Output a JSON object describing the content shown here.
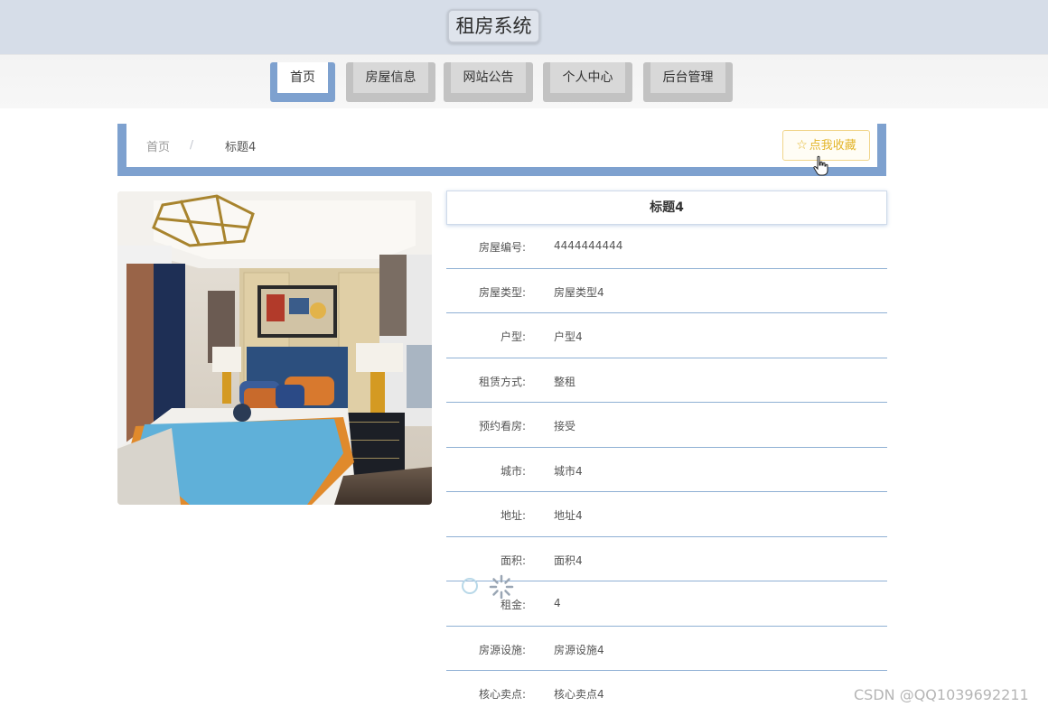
{
  "header": {
    "site_title": "租房系统"
  },
  "nav": {
    "items": [
      "首页",
      "房屋信息",
      "网站公告",
      "个人中心",
      "后台管理"
    ],
    "active": "首页"
  },
  "breadcrumb": {
    "home": "首页",
    "separator": "/",
    "current": "标题4"
  },
  "favorite_button": {
    "label": "点我收藏",
    "icon": "star-outline-icon"
  },
  "detail": {
    "title": "标题4",
    "fields": [
      {
        "label": "房屋编号:",
        "value": "4444444444"
      },
      {
        "label": "房屋类型:",
        "value": "房屋类型4"
      },
      {
        "label": "户型:",
        "value": "户型4"
      },
      {
        "label": "租赁方式:",
        "value": "整租"
      },
      {
        "label": "预约看房:",
        "value": "接受"
      },
      {
        "label": "城市:",
        "value": "城市4"
      },
      {
        "label": "地址:",
        "value": "地址4"
      },
      {
        "label": "面积:",
        "value": "面积4"
      },
      {
        "label": "租金:",
        "value": "4"
      },
      {
        "label": "房源设施:",
        "value": "房源设施4"
      },
      {
        "label": "核心卖点:",
        "value": "核心卖点4"
      }
    ]
  },
  "watermark": "CSDN @QQ1039692211",
  "colors": {
    "accent": "#7ea1cf",
    "header_bg": "#d6dde8",
    "favorite": "#e3b52a"
  }
}
